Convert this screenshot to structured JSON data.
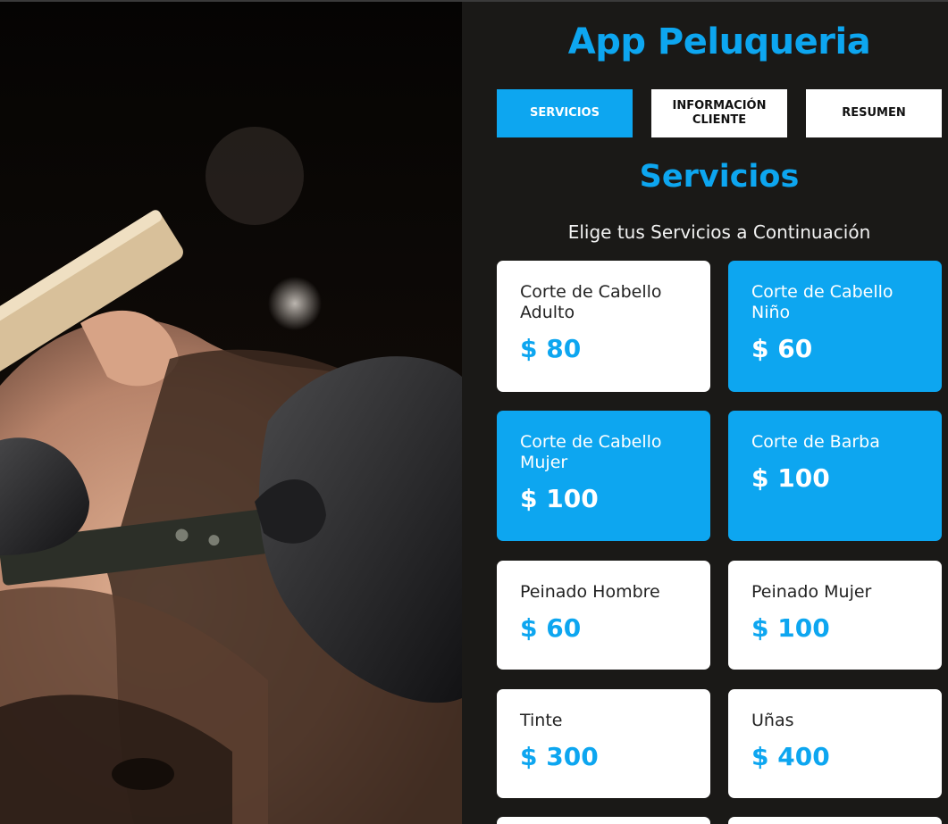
{
  "app": {
    "title": "App Peluqueria",
    "accent_color": "#0da6f0",
    "background_color": "#1a1917"
  },
  "tabs": [
    {
      "label": "SERVICIOS",
      "active": true
    },
    {
      "label": "INFORMACIÓN CLIENTE",
      "active": false
    },
    {
      "label": "RESUMEN",
      "active": false
    }
  ],
  "section": {
    "title": "Servicios",
    "subtitle": "Elige tus Servicios a Continuación"
  },
  "services": [
    {
      "name": "Corte de Cabello Adulto",
      "price": "$ 80",
      "selected": false
    },
    {
      "name": "Corte de Cabello Niño",
      "price": "$ 60",
      "selected": true
    },
    {
      "name": "Corte de Cabello Mujer",
      "price": "$ 100",
      "selected": true
    },
    {
      "name": "Corte de Barba",
      "price": "$ 100",
      "selected": true
    },
    {
      "name": "Peinado Hombre",
      "price": "$ 60",
      "selected": false
    },
    {
      "name": "Peinado Mujer",
      "price": "$ 100",
      "selected": false
    },
    {
      "name": "Tinte",
      "price": "$ 300",
      "selected": false
    },
    {
      "name": "Uñas",
      "price": "$ 400",
      "selected": false
    }
  ]
}
